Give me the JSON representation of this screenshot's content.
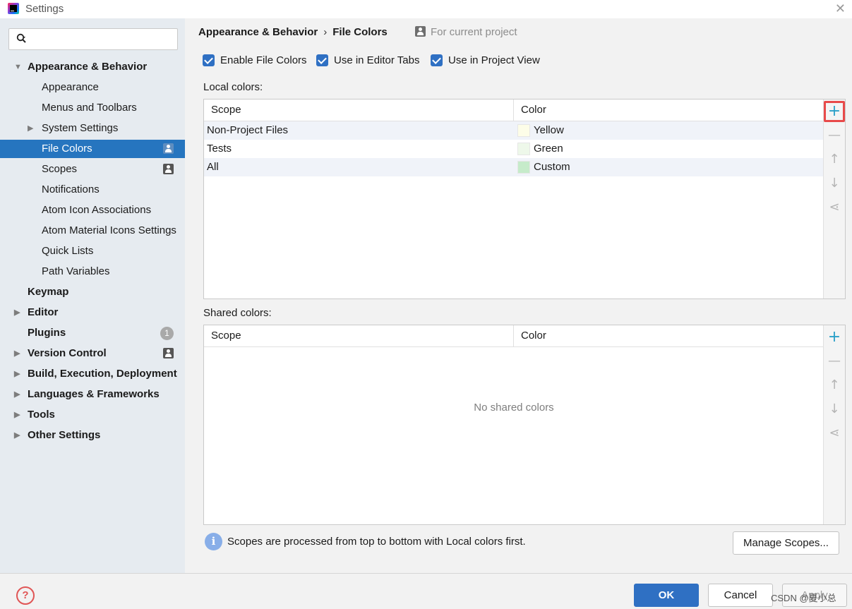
{
  "window": {
    "title": "Settings",
    "close_glyph": "✕"
  },
  "sidebar": {
    "search_placeholder": "",
    "items": [
      {
        "label": "Appearance & Behavior",
        "bold": true,
        "arrow": "▼",
        "expanded": true
      },
      {
        "label": "Appearance"
      },
      {
        "label": "Menus and Toolbars"
      },
      {
        "label": "System Settings",
        "arrow": "▶"
      },
      {
        "label": "File Colors",
        "selected": true,
        "badge": "project-icon"
      },
      {
        "label": "Scopes",
        "badge": "project-icon"
      },
      {
        "label": "Notifications"
      },
      {
        "label": "Atom Icon Associations"
      },
      {
        "label": "Atom Material Icons Settings"
      },
      {
        "label": "Quick Lists"
      },
      {
        "label": "Path Variables"
      },
      {
        "label": "Keymap",
        "bold": true
      },
      {
        "label": "Editor",
        "bold": true,
        "arrow": "▶"
      },
      {
        "label": "Plugins",
        "bold": true,
        "badge_count": "1"
      },
      {
        "label": "Version Control",
        "bold": true,
        "arrow": "▶",
        "badge": "project-icon"
      },
      {
        "label": "Build, Execution, Deployment",
        "bold": true,
        "arrow": "▶"
      },
      {
        "label": "Languages & Frameworks",
        "bold": true,
        "arrow": "▶"
      },
      {
        "label": "Tools",
        "bold": true,
        "arrow": "▶"
      },
      {
        "label": "Other Settings",
        "bold": true,
        "arrow": "▶"
      }
    ]
  },
  "header": {
    "breadcrumb_parent": "Appearance & Behavior",
    "breadcrumb_sep": "›",
    "breadcrumb_current": "File Colors",
    "scope_note": "For current project"
  },
  "options": {
    "enable_file_colors": {
      "label": "Enable File Colors",
      "checked": true
    },
    "use_in_editor_tabs": {
      "label": "Use in Editor Tabs",
      "checked": true
    },
    "use_in_project_view": {
      "label": "Use in Project View",
      "checked": true
    }
  },
  "local": {
    "label": "Local colors:",
    "col_scope": "Scope",
    "col_color": "Color",
    "rows": [
      {
        "scope": "Non-Project Files",
        "color": "Yellow",
        "swatch": "#fdfde8"
      },
      {
        "scope": "Tests",
        "color": "Green",
        "swatch": "#eef8ea"
      },
      {
        "scope": "All",
        "color": "Custom",
        "swatch": "#c6ebca"
      }
    ]
  },
  "shared": {
    "label": "Shared colors:",
    "col_scope": "Scope",
    "col_color": "Color",
    "empty_text": "No shared colors"
  },
  "toolbar": {
    "add": "+",
    "remove": "—",
    "up": "↑",
    "down": "↓",
    "share": "⋖"
  },
  "info": {
    "glyph": "i",
    "text": "Scopes are processed from top to bottom with Local colors first."
  },
  "buttons": {
    "manage_scopes": "Manage Scopes...",
    "ok": "OK",
    "cancel": "Cancel",
    "apply": "Apply",
    "help_glyph": "?"
  },
  "watermark": "CSDN @夏小总",
  "colors": {
    "accent": "#2f70c3",
    "selection": "#2675bf",
    "sidebar_bg": "#e6ebf0",
    "highlight_border": "#e84a4a"
  }
}
